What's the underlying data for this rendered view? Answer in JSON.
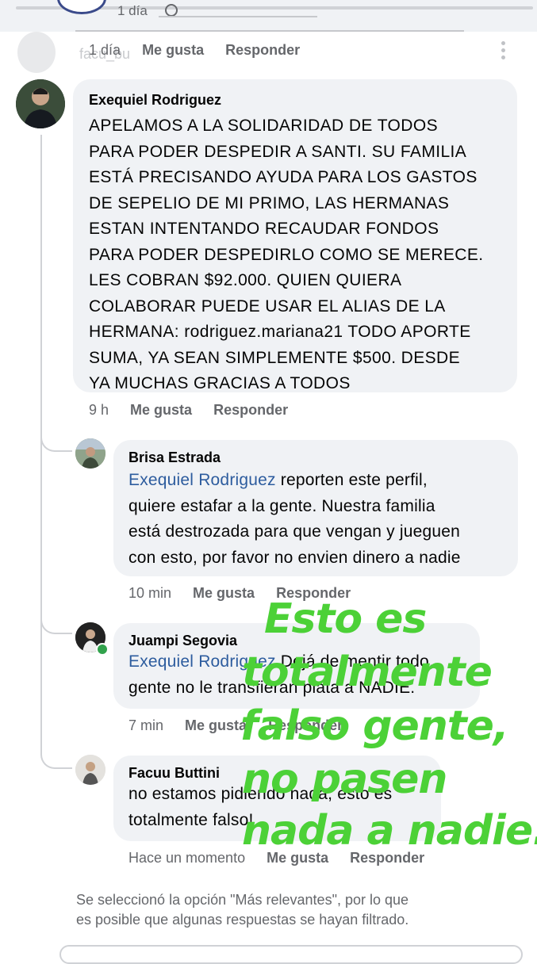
{
  "top": {
    "time": "1 día",
    "separator": "·"
  },
  "ghost_comment": {
    "author_partial": "facu_bu",
    "time": "1 día",
    "like": "Me gusta",
    "reply": "Responder"
  },
  "comments": [
    {
      "author": "Exequiel Rodriguez",
      "lines": [
        "APELAMOS A LA SOLIDARIDAD DE TODOS",
        "PARA PODER DESPEDIR A SANTI. SU FAMILIA",
        "ESTÁ PRECISANDO AYUDA PARA LOS GASTOS",
        "DE SEPELIO DE MI PRIMO, LAS HERMANAS",
        "ESTAN INTENTANDO RECAUDAR FONDOS",
        "PARA PODER DESPEDIRLO COMO SE MERECE.",
        "LES COBRAN $92.000. QUIEN QUIERA",
        "COLABORAR PUEDE USAR EL ALIAS DE LA",
        "HERMANA: rodriguez.mariana21 TODO APORTE",
        "SUMA, YA SEAN SIMPLEMENTE $500. DESDE",
        "YA MUCHAS GRACIAS A TODOS"
      ],
      "time": "9 h",
      "like": "Me gusta",
      "reply": "Responder"
    },
    {
      "author": "Brisa Estrada",
      "mention": "Exequiel Rodriguez",
      "first_line_rest": " reporten este perfil,",
      "lines": [
        "quiere estafar a la gente. Nuestra familia",
        "está destrozada para que vengan y jueguen",
        "con esto, por favor no envien dinero a nadie"
      ],
      "time": "10 min",
      "like": "Me gusta",
      "reply": "Responder"
    },
    {
      "author": "Juampi Segovia",
      "mention": "Exequiel Rodriguez",
      "first_line_rest": " Dejá de mentir todo,",
      "lines": [
        "gente no le transfieran plata a NADIE."
      ],
      "time": "7 min",
      "like": "Me gusta",
      "reply": "Responder"
    },
    {
      "author": "Facuu Buttini",
      "lines": [
        "no estamos pidiendo nada, esto es",
        "totalmente falso!"
      ],
      "time": "Hace un momento",
      "like": "Me gusta",
      "reply": "Responder"
    }
  ],
  "overlay_lines": [
    "Esto es",
    "totalmente",
    "falso gente,",
    "no pasen",
    "nada a nadie.."
  ],
  "footer": {
    "line1": "Se seleccionó la opción \"Más relevantes\", por lo que",
    "line2": "es posible que algunas respuestas se hayan filtrado."
  },
  "colors": {
    "overlay": "#4cd137",
    "mention": "#2d5c9e",
    "bubble": "#f0f2f5",
    "meta": "#65676b"
  }
}
